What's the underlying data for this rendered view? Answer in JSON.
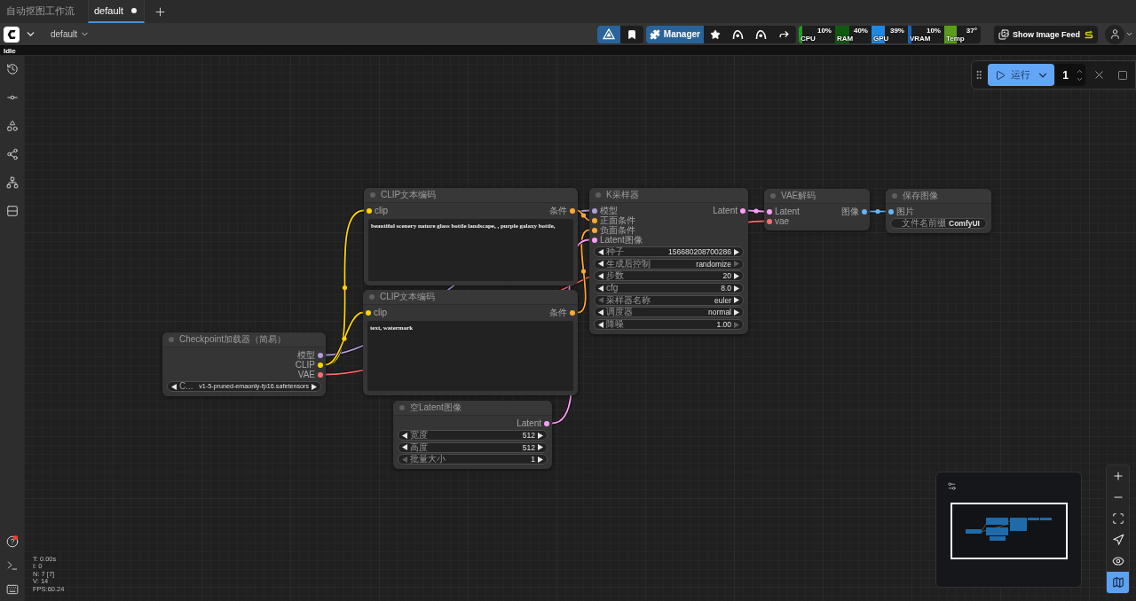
{
  "tabs": [
    {
      "label": "自动抠图工作流",
      "selected": false,
      "modified": false
    },
    {
      "label": "default",
      "selected": true,
      "modified": true
    }
  ],
  "menu_bar": {
    "workflow_name": "default",
    "manager_label": "Manager",
    "monitors": [
      {
        "label": "CPU",
        "reading": "10%",
        "level": 0.1,
        "color": "#1f9e1f"
      },
      {
        "label": "RAM",
        "reading": "40%",
        "level": 0.4,
        "color": "#0e5a0e"
      },
      {
        "label": "GPU",
        "reading": "39%",
        "level": 0.39,
        "color": "#1e88e5"
      },
      {
        "label": "VRAM",
        "reading": "10%",
        "level": 0.1,
        "color": "#1565c0"
      },
      {
        "label": "Temp",
        "reading": "37°",
        "level": 0.37,
        "color": "#5a9e18"
      }
    ],
    "image_feed_label": "Show Image Feed"
  },
  "status": "Idle",
  "sidebar": {
    "help_notification": true
  },
  "run_panel": {
    "run_label": "运行",
    "batch_count": "1"
  },
  "nodes": [
    {
      "title": "CLIP文本编码",
      "inputs": [
        {
          "label": "clip",
          "color": "#ffd500"
        }
      ],
      "outputs": [
        {
          "label": "条件",
          "color": "#ffa931"
        }
      ],
      "widgets": [
        {
          "kind": "textarea",
          "value": "beautiful scenery nature glass bottle landscape, , purple galaxy bottle,"
        }
      ]
    },
    {
      "title": "K采样器",
      "inputs": [
        {
          "label": "模型",
          "color": "#b39ddb"
        },
        {
          "label": "正面条件",
          "color": "#ffa931"
        },
        {
          "label": "负面条件",
          "color": "#ffa931"
        },
        {
          "label": "Latent图像",
          "color": "#ff9cf9"
        }
      ],
      "outputs": [
        {
          "label": "Latent",
          "color": "#ff9cf9"
        }
      ],
      "widgets": [
        {
          "kind": "stepper",
          "label": "种子",
          "value": "156680208700286",
          "left_disabled": false,
          "right_disabled": false
        },
        {
          "kind": "stepper",
          "label": "生成后控制",
          "value": "randomize",
          "left_disabled": false,
          "right_disabled": true
        },
        {
          "kind": "stepper",
          "label": "步数",
          "value": "20",
          "left_disabled": false,
          "right_disabled": false
        },
        {
          "kind": "stepper",
          "label": "cfg",
          "value": "8.0",
          "left_disabled": false,
          "right_disabled": false
        },
        {
          "kind": "stepper",
          "label": "采样器名称",
          "value": "euler",
          "left_disabled": true,
          "right_disabled": false
        },
        {
          "kind": "stepper",
          "label": "调度器",
          "value": "normal",
          "left_disabled": false,
          "right_disabled": false
        },
        {
          "kind": "stepper",
          "label": "降噪",
          "value": "1.00",
          "left_disabled": false,
          "right_disabled": true
        }
      ]
    },
    {
      "title": "VAE解码",
      "inputs": [
        {
          "label": "Latent",
          "color": "#ff9cf9"
        },
        {
          "label": "vae",
          "color": "#ff6e6e"
        }
      ],
      "outputs": [
        {
          "label": "图像",
          "color": "#64b5f6"
        }
      ]
    },
    {
      "title": "保存图像",
      "inputs": [
        {
          "label": "图片",
          "color": "#64b5f6"
        }
      ],
      "widgets": [
        {
          "kind": "text",
          "label": "文件名前缀",
          "value": "ComfyUI"
        }
      ]
    },
    {
      "title": "CLIP文本编码",
      "inputs": [
        {
          "label": "clip",
          "color": "#ffd500"
        }
      ],
      "outputs": [
        {
          "label": "条件",
          "color": "#ffa931"
        }
      ],
      "widgets": [
        {
          "kind": "textarea",
          "value": "text, watermark"
        }
      ]
    },
    {
      "title": "Checkpoint加载器（简易）",
      "outputs": [
        {
          "label": "模型",
          "color": "#b39ddb"
        },
        {
          "label": "CLIP",
          "color": "#ffd500"
        },
        {
          "label": "VAE",
          "color": "#ff6e6e"
        }
      ],
      "widgets": [
        {
          "kind": "stepper",
          "label": "C...",
          "value": "v1-5-pruned-emaonly-fp16.safetensors",
          "left_disabled": false,
          "right_disabled": false
        }
      ]
    },
    {
      "title": "空Latent图像",
      "outputs": [
        {
          "label": "Latent",
          "color": "#ff9cf9"
        }
      ],
      "widgets": [
        {
          "kind": "stepper",
          "label": "宽度",
          "value": "512",
          "left_disabled": false,
          "right_disabled": false
        },
        {
          "kind": "stepper",
          "label": "高度",
          "value": "512",
          "left_disabled": false,
          "right_disabled": false
        },
        {
          "kind": "stepper",
          "label": "批量大小",
          "value": "1",
          "left_disabled": true,
          "right_disabled": false
        }
      ]
    }
  ],
  "render_stats": [
    "T: 0.00s",
    "I: 0",
    "N: 7 [7]",
    "V: 14",
    "FPS:60.24"
  ],
  "canvas_controls": {
    "minimap": true
  }
}
